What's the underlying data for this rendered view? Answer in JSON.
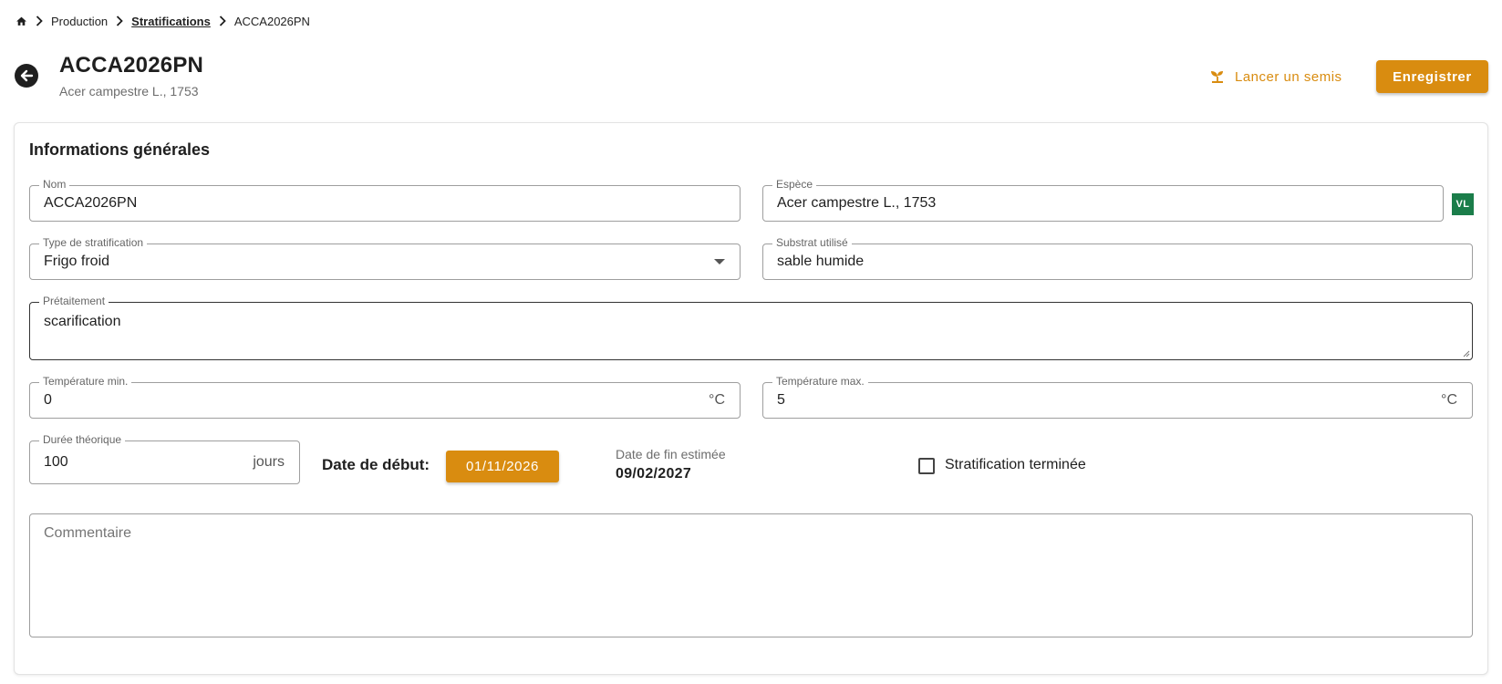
{
  "breadcrumb": {
    "home_icon": "home-icon",
    "items": [
      "Production",
      "Stratifications",
      "ACCA2026PN"
    ]
  },
  "header": {
    "title": "ACCA2026PN",
    "subtitle": "Acer campestre L., 1753",
    "semis_label": "Lancer un semis",
    "semis_icon": "sprout-icon",
    "save_label": "Enregistrer"
  },
  "section": {
    "title": "Informations générales"
  },
  "form": {
    "nom": {
      "label": "Nom",
      "value": "ACCA2026PN"
    },
    "espece": {
      "label": "Espèce",
      "value": "Acer campestre L., 1753",
      "badge": "VL"
    },
    "type": {
      "label": "Type de stratification",
      "value": "Frigo froid"
    },
    "substrat": {
      "label": "Substrat utilisé",
      "value": "sable humide"
    },
    "pretraitement": {
      "label": "Prétaitement",
      "value": "scarification"
    },
    "temp_min": {
      "label": "Température min.",
      "value": "0",
      "unit": "°C"
    },
    "temp_max": {
      "label": "Température max.",
      "value": "5",
      "unit": "°C"
    },
    "duree": {
      "label": "Durée théorique",
      "value": "100",
      "unit": "jours"
    },
    "date_debut": {
      "label": "Date de début:",
      "value": "01/11/2026"
    },
    "date_fin": {
      "label": "Date de fin estimée",
      "value": "09/02/2027"
    },
    "terminee": {
      "label": "Stratification terminée",
      "checked": false
    },
    "commentaire": {
      "placeholder": "Commentaire",
      "value": ""
    }
  },
  "colors": {
    "accent": "#d98c10",
    "badge_green": "#1b7d4a"
  }
}
